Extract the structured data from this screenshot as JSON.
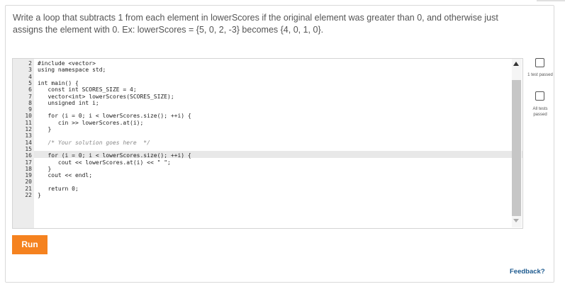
{
  "prompt": {
    "line1": "Write a loop that subtracts 1 from each element in lowerScores if the original element was greater than 0, and otherwise just",
    "line2": "assigns the element with 0. Ex: lowerScores = {5, 0, 2, -3} becomes {4, 0, 1, 0}."
  },
  "editor": {
    "line_numbers": [
      "2",
      "3",
      "4",
      "5",
      "6",
      "7",
      "8",
      "9",
      "10",
      "11",
      "12",
      "13",
      "14",
      "15",
      "16",
      "17",
      "18",
      "19",
      "20",
      "21",
      "22"
    ],
    "lines": [
      "#include <vector>",
      "using namespace std;",
      "",
      "int main() {",
      "   const int SCORES_SIZE = 4;",
      "   vector<int> lowerScores(SCORES_SIZE);",
      "   unsigned int i;",
      "",
      "   for (i = 0; i < lowerScores.size(); ++i) {",
      "      cin >> lowerScores.at(i);",
      "   }",
      "",
      "   /* Your solution goes here  */",
      "",
      "   for (i = 0; i < lowerScores.size(); ++i) {",
      "      cout << lowerScores.at(i) << \" \";",
      "   }",
      "   cout << endl;",
      "",
      "   return 0;",
      "}"
    ]
  },
  "tests": {
    "test1_label": "1 test passed",
    "test2_label": "All tests passed"
  },
  "run_label": "Run",
  "feedback_label": "Feedback?"
}
